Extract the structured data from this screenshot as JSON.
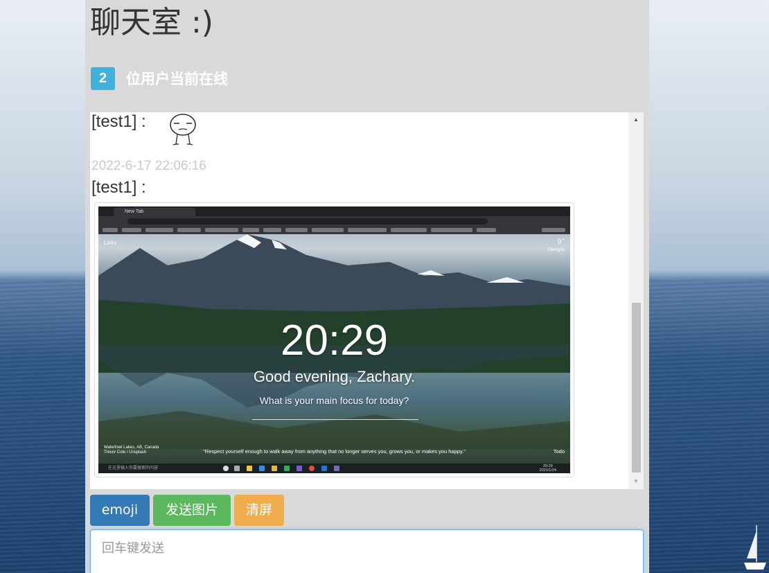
{
  "room": {
    "title": "聊天室 :)"
  },
  "online": {
    "count": "2",
    "label": "位用户当前在线"
  },
  "messages": [
    {
      "user": "[test1] :",
      "type": "emoji",
      "emoji_icon": "face-emoji-icon"
    },
    {
      "time": "2022-6-17 22:06:16",
      "user": "[test1] :",
      "type": "image"
    }
  ],
  "screenshot": {
    "tab_title": "New Tab",
    "links": "Links",
    "weather_temp": "9°",
    "weather_city": "Chengdu",
    "clock": "20:29",
    "greeting": "Good evening, Zachary.",
    "focus_prompt": "What is your main focus for today?",
    "quote": "\"Respect yourself enough to walk away from anything that no longer serves you, grows you, or makes you happy.\"",
    "todo": "Todo",
    "location": "Waterfowl Lakes, AB, Canada",
    "location_sub": "Trevor Cole / Unsplash",
    "taskbar_search": "在这里输入你要搜索的内容",
    "tray_time": "20:29",
    "tray_date": "2021/1/24"
  },
  "toolbar": {
    "emoji_label": "emoji",
    "send_image_label": "发送图片",
    "clear_label": "清屏"
  },
  "input": {
    "placeholder": "回车键发送"
  },
  "colors": {
    "emoji_btn": "#337ab7",
    "image_btn": "#5cb85c",
    "clear_btn": "#f0ad4e",
    "badge": "#3fb1dd"
  }
}
